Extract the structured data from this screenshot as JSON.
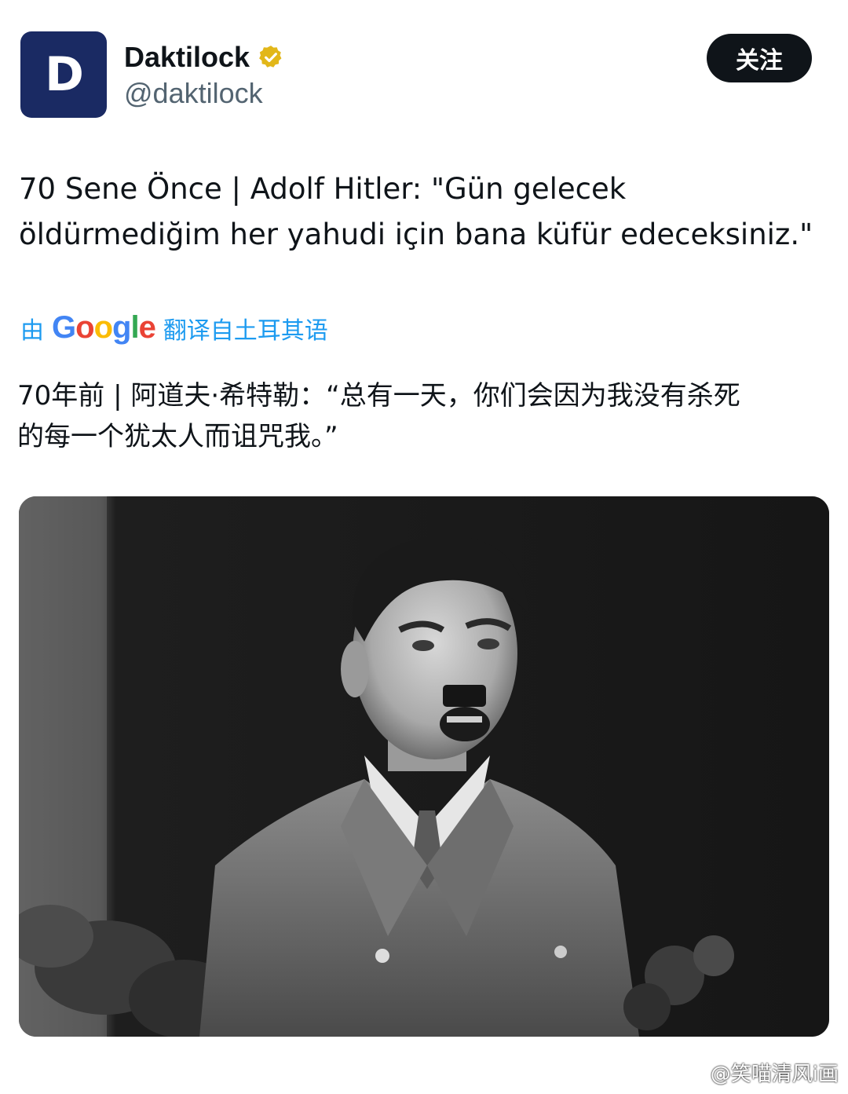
{
  "author": {
    "avatar_letter": "D",
    "display_name": "Daktilock",
    "handle": "@daktilock",
    "verified_color": "#e2b719"
  },
  "follow_button": {
    "label": "关注"
  },
  "tweet": {
    "text": "70 Sene Önce | Adolf Hitler: \"Gün gelecek\nöldürmediğim her yahudi için bana küfür edeceksiniz.\""
  },
  "translation": {
    "prefix": "由",
    "provider": "Google",
    "suffix": "翻译自土耳其语",
    "text": "70年前 | 阿道夫·希特勒：“总有一天，你们会因为我没有杀死\n的每一个犹太人而诅咒我。”"
  },
  "watermark": {
    "text": "@笑喵清风i画"
  },
  "colors": {
    "text_primary": "#0f1419",
    "text_secondary": "#536471",
    "link_blue": "#1d9bf0",
    "avatar_bg": "#1a2a63"
  }
}
